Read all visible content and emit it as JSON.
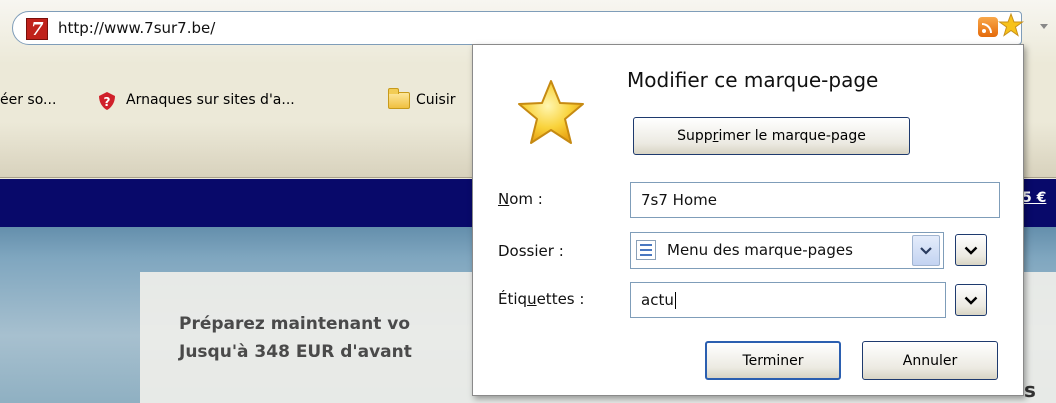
{
  "browser": {
    "url": "http://www.7sur7.be/",
    "favicon_letter": "7"
  },
  "bookmarks_toolbar": {
    "items": [
      {
        "label": "éer so..."
      },
      {
        "label": "Arnaques sur sites d'a..."
      },
      {
        "label": "Cuisir"
      }
    ]
  },
  "page": {
    "price_fragment": "5 €",
    "promo_line1": "Préparez maintenant vo",
    "promo_line2": "Jusqu'à 348 EUR d'avant",
    "promo_fragment": "s"
  },
  "bookmark_panel": {
    "title": "Modifier ce marque-page",
    "delete_button": {
      "pre": "Supp",
      "access": "r",
      "post": "imer le marque-page"
    },
    "name_label": {
      "access": "N",
      "post": "om :"
    },
    "name_value": "7s7 Home",
    "folder_label": "Dossier :",
    "folder_value": "Menu des marque-pages",
    "tags_label": {
      "pre": "Étiq",
      "access": "u",
      "post": "ettes :"
    },
    "tags_value": "actu",
    "done_button": "Terminer",
    "cancel_button": "Annuler"
  },
  "colors": {
    "navy_bar": "#08096a",
    "star": "#f7c21a",
    "focus_border": "#2b5fb0"
  }
}
